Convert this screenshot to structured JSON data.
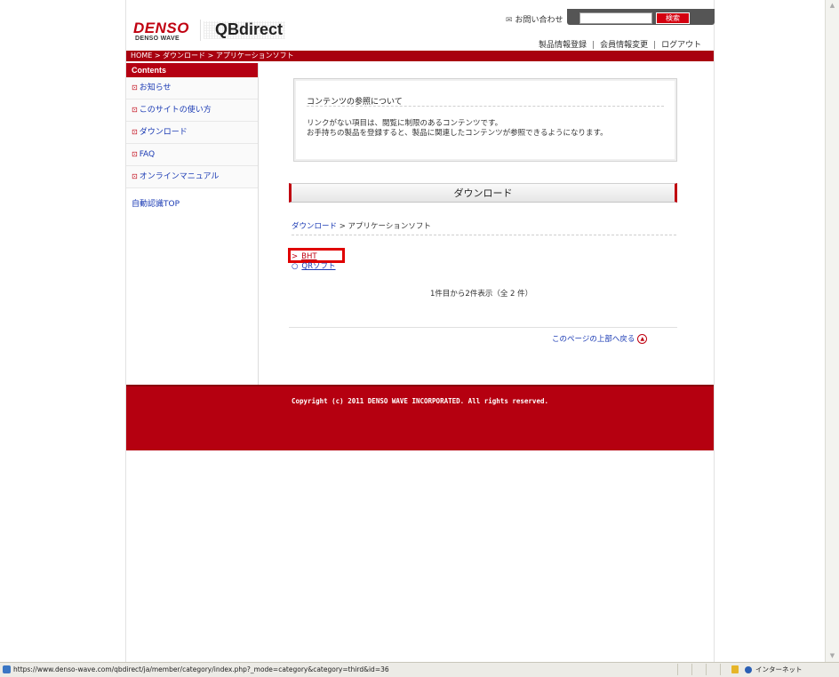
{
  "header": {
    "logo_denso": "DENSO",
    "logo_wave": "DENSO WAVE",
    "logo_qb": "QBdirect",
    "contact": "お問い合わせ",
    "search_button": "検索",
    "search_value": "",
    "member_links": [
      "製品情報登録",
      "会員情報変更",
      "ログアウト"
    ]
  },
  "breadcrumb": "HOME > ダウンロード > アプリケーションソフト",
  "sidebar": {
    "heading": "Contents",
    "items": [
      {
        "label": "お知らせ"
      },
      {
        "label": "このサイトの使い方"
      },
      {
        "label": "ダウンロード"
      },
      {
        "label": "FAQ"
      },
      {
        "label": "オンラインマニュアル"
      }
    ],
    "extra": "自動認識TOP"
  },
  "notice": {
    "title": "コンテンツの参照について",
    "line1": "リンクがない項目は、閲覧に制限のあるコンテンツです。",
    "line2": "お手持ちの製品を登録すると、製品に関連したコンテンツが参照できるようになります。"
  },
  "main": {
    "section_title": "ダウンロード",
    "path_link": "ダウンロード",
    "path_sep": " > ",
    "path_current": "アプリケーションソフト",
    "categories": [
      {
        "marker": ">",
        "label": "BHT"
      },
      {
        "marker": "○",
        "label": "QRソフト"
      }
    ],
    "count_text": "1件目から2件表示（全 2 件）",
    "to_top": "このページの上部へ戻る"
  },
  "footer": {
    "copyright": "Copyright (c) 2011 DENSO WAVE INCORPORATED. All rights reserved."
  },
  "statusbar": {
    "url": "https://www.denso-wave.com/qbdirect/ja/member/category/index.php?_mode=category&category=third&id=36",
    "zone": "インターネット"
  },
  "colors": {
    "brand_red": "#b50010",
    "link_blue": "#1a3ab4",
    "highlight_red": "#e00000"
  }
}
